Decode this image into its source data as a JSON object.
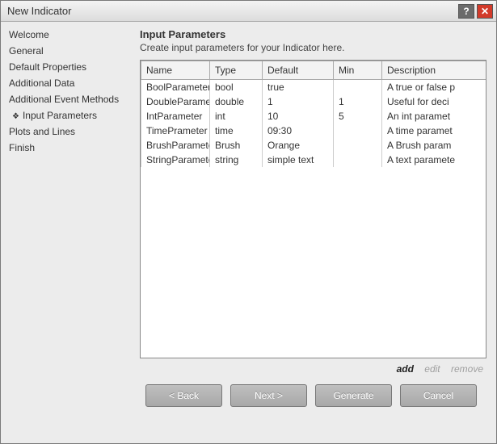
{
  "window": {
    "title": "New Indicator"
  },
  "sidebar": {
    "items": [
      {
        "label": "Welcome"
      },
      {
        "label": "General"
      },
      {
        "label": "Default Properties"
      },
      {
        "label": "Additional Data"
      },
      {
        "label": "Additional Event Methods"
      },
      {
        "label": "Input Parameters"
      },
      {
        "label": "Plots and Lines"
      },
      {
        "label": "Finish"
      }
    ],
    "active_index": 5
  },
  "main": {
    "heading": "Input Parameters",
    "description": "Create input parameters for your Indicator here.",
    "columns": {
      "name": "Name",
      "type": "Type",
      "default": "Default",
      "min": "Min",
      "description": "Description"
    },
    "rows": [
      {
        "name": "BoolParameter",
        "type": "bool",
        "default": "true",
        "min": "",
        "description": "A true or false p"
      },
      {
        "name": "DoubleParameter",
        "type": "double",
        "default": "1",
        "min": "1",
        "description": "Useful for deci"
      },
      {
        "name": "IntParameter",
        "type": "int",
        "default": "10",
        "min": "5",
        "description": "An int paramet"
      },
      {
        "name": "TimePrameter",
        "type": "time",
        "default": "09:30",
        "min": "",
        "description": "A time paramet"
      },
      {
        "name": "BrushParameter",
        "type": "Brush",
        "default": "Orange",
        "min": "",
        "description": "A Brush param"
      },
      {
        "name": "StringParameter",
        "type": "string",
        "default": "simple text",
        "min": "",
        "description": "A text paramete"
      }
    ],
    "actions": {
      "add": "add",
      "edit": "edit",
      "remove": "remove"
    }
  },
  "footer": {
    "back": "< Back",
    "next": "Next >",
    "generate": "Generate",
    "cancel": "Cancel"
  }
}
